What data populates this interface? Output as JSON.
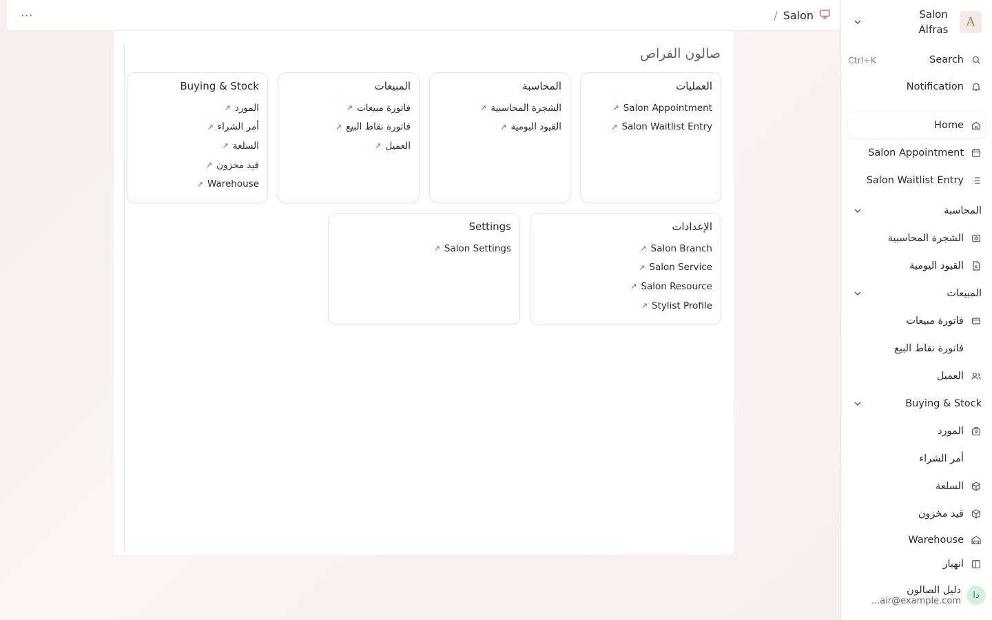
{
  "topbar": {
    "more": "···",
    "breadcrumb_sep": "/",
    "breadcrumb_current": "Salon"
  },
  "workspace": {
    "title": "صالون الفراص",
    "cards": [
      {
        "title": "العمليات",
        "links": [
          "Salon Appointment",
          "Salon Waitlist Entry"
        ]
      },
      {
        "title": "المحاسبة",
        "links": [
          "الشجرة المحاسبية",
          "القيود اليومية"
        ]
      },
      {
        "title": "المبيعات",
        "links": [
          "فاتورة مبيعات",
          "فاتورة نقاط البيع",
          "العميل"
        ]
      },
      {
        "title": "Buying & Stock",
        "links": [
          "المورد",
          "أمر الشراء",
          "السلعة",
          "قيد مخزون",
          "Warehouse"
        ]
      },
      {
        "title": "الإعدادات",
        "links": [
          "Salon Branch",
          "Salon Service",
          "Salon Resource",
          "Stylist Profile"
        ]
      },
      {
        "title": "Settings",
        "links": [
          "Salon Settings"
        ]
      }
    ],
    "link_arrow": "↗"
  },
  "sidebar": {
    "brand_name": "Salon Alfras",
    "logo_text": "A",
    "search_label": "Search",
    "search_shortcut": "Ctrl+K",
    "notification_label": "Notification",
    "home": "Home",
    "items": [
      {
        "label": "Salon Appointment",
        "icon": "calendar-icon"
      },
      {
        "label": "Salon Waitlist Entry",
        "icon": "list-icon"
      }
    ],
    "groups": [
      {
        "label": "المحاسبة",
        "items": [
          {
            "label": "الشجرة المحاسبية",
            "icon": "eye-box-icon"
          },
          {
            "label": "القيود اليومية",
            "icon": "file-icon"
          }
        ]
      },
      {
        "label": "المبيعات",
        "items": [
          {
            "label": "فاتورة مبيعات",
            "icon": "card-icon"
          },
          {
            "label": "فاتورة نقاط البيع",
            "icon": ""
          },
          {
            "label": "العميل",
            "icon": "users-icon"
          }
        ]
      },
      {
        "label": "Buying & Stock",
        "items": [
          {
            "label": "المورد",
            "icon": "supplier-icon"
          },
          {
            "label": "أمر الشراء",
            "icon": ""
          },
          {
            "label": "السلعة",
            "icon": "box-icon"
          },
          {
            "label": "قيد مخزون",
            "icon": "box-icon"
          },
          {
            "label": "Warehouse",
            "icon": "warehouse-icon"
          }
        ]
      }
    ],
    "collapse_label": "انهيار",
    "user": {
      "avatar": "دا",
      "name": "دليل الصالون",
      "email": "...air@example.com"
    }
  },
  "colors": {
    "accent": "#c04a5e",
    "text": "#2f2a2a",
    "background": "#f8efef"
  }
}
